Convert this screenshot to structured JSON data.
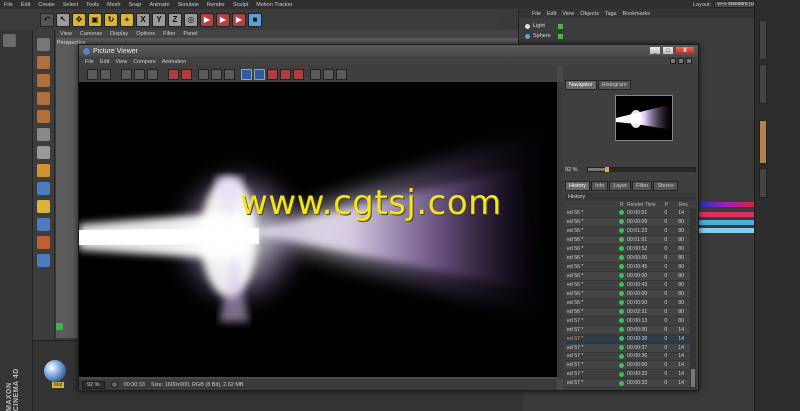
{
  "app": {
    "menu": [
      "File",
      "Edit",
      "Create",
      "Select",
      "Tools",
      "Mesh",
      "Snap",
      "Animate",
      "Simulate",
      "Render",
      "Sculpt",
      "Motion Tracker"
    ],
    "layout_label": "Layout:",
    "layout_value": "VFX standard (User)",
    "toolbar_axes": [
      "X",
      "Y",
      "Z"
    ]
  },
  "viewport": {
    "menu": [
      "View",
      "Cameras",
      "Display",
      "Options",
      "Filter",
      "Panel"
    ],
    "label": "Perspective"
  },
  "object_manager": {
    "menu": [
      "File",
      "Edit",
      "View",
      "Objects",
      "Tags",
      "Bookmarks"
    ],
    "objects": [
      {
        "name": "Light",
        "color": "#e0e0e0"
      },
      {
        "name": "Sphere",
        "color": "#6aa0d8"
      }
    ]
  },
  "picture_viewer": {
    "title": "Picture Viewer",
    "menu": [
      "File",
      "Edit",
      "View",
      "Compare",
      "Animation"
    ],
    "window_buttons": {
      "minimize": "_",
      "maximize": "□",
      "close": "X"
    },
    "navigator": {
      "tabs": [
        "Navigator",
        "Histogram"
      ],
      "active_tab": "Navigator",
      "zoom": "92 %",
      "zoom_fraction": 0.18
    },
    "history": {
      "tabs": [
        "History",
        "Info",
        "Layer",
        "Filter",
        "Stereo"
      ],
      "active_tab": "History",
      "title": "History",
      "columns": [
        "",
        "R",
        "Render Time",
        "P",
        "Res"
      ],
      "rows": [
        {
          "name": "ed 55 *",
          "time": "00:00:51",
          "p": "0",
          "res": "14"
        },
        {
          "name": "ed 56 *",
          "time": "00:00:09",
          "p": "0",
          "res": "80"
        },
        {
          "name": "ed 56 *",
          "time": "00:01:23",
          "p": "0",
          "res": "80"
        },
        {
          "name": "ed 56 *",
          "time": "00:01:01",
          "p": "0",
          "res": "80"
        },
        {
          "name": "ed 56 *",
          "time": "00:00:52",
          "p": "0",
          "res": "80"
        },
        {
          "name": "ed 56 *",
          "time": "00:00:00",
          "p": "0",
          "res": "80"
        },
        {
          "name": "ed 56 *",
          "time": "00:00:45",
          "p": "0",
          "res": "80"
        },
        {
          "name": "ed 56 *",
          "time": "00:00:00",
          "p": "0",
          "res": "80"
        },
        {
          "name": "ed 56 *",
          "time": "00:00:43",
          "p": "0",
          "res": "80"
        },
        {
          "name": "ed 56 *",
          "time": "00:00:00",
          "p": "0",
          "res": "80"
        },
        {
          "name": "ed 56 *",
          "time": "00:00:00",
          "p": "0",
          "res": "80"
        },
        {
          "name": "ed 56 *",
          "time": "00:02:31",
          "p": "0",
          "res": "80"
        },
        {
          "name": "ed 57 *",
          "time": "00:00:13",
          "p": "0",
          "res": "80"
        },
        {
          "name": "ed 57 *",
          "time": "00:00:00",
          "p": "0",
          "res": "14"
        },
        {
          "name": "ed 57 *",
          "time": "00:00:38",
          "p": "0",
          "res": "14",
          "selected": true
        },
        {
          "name": "ed 57 *",
          "time": "00:00:37",
          "p": "0",
          "res": "14"
        },
        {
          "name": "ed 57 *",
          "time": "00:00:36",
          "p": "0",
          "res": "14"
        },
        {
          "name": "ed 57 *",
          "time": "00:00:00",
          "p": "0",
          "res": "14"
        },
        {
          "name": "ed 57 *",
          "time": "00:00:33",
          "p": "0",
          "res": "14"
        },
        {
          "name": "ed 57 *",
          "time": "00:00:33",
          "p": "0",
          "res": "14"
        }
      ]
    },
    "status": {
      "zoom": "92 %",
      "time": "00:00:33",
      "info": "Size: 1600x900, RGB (8 Bit), 2.62 MB"
    }
  },
  "material": {
    "label": "Mat"
  },
  "logo": "MAXON CINEMA 4D",
  "watermark": "www.cgtsj.com"
}
